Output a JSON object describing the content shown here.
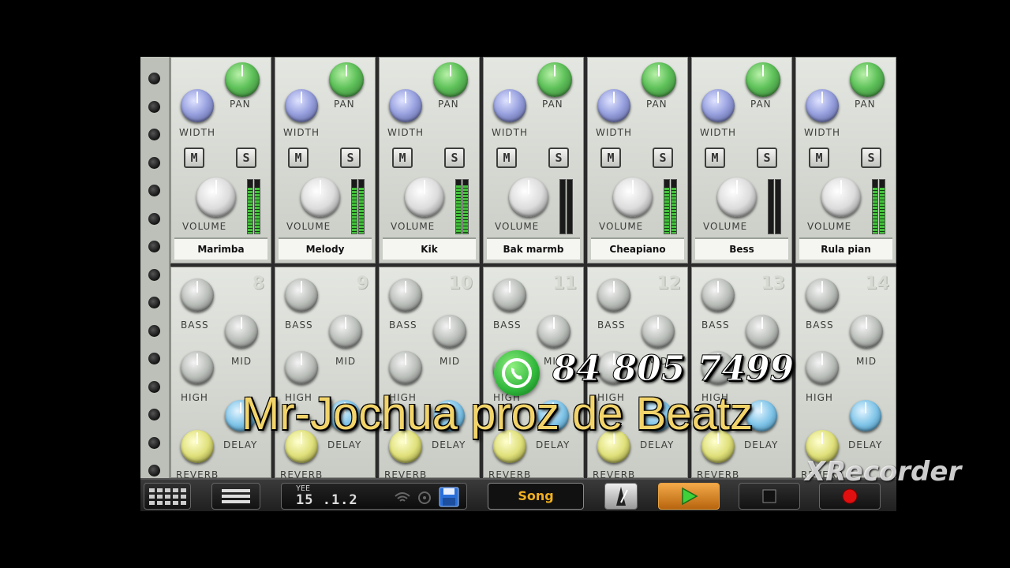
{
  "mixer": {
    "top_labels": {
      "pan": "PAN",
      "width": "WIDTH",
      "volume": "VOLUME",
      "mute": "M",
      "solo": "S"
    },
    "bottom_labels": {
      "bass": "BASS",
      "mid": "MID",
      "high": "HIGH",
      "delay": "DELAY",
      "reverb": "REVERB"
    },
    "channels": [
      {
        "name": "Marimba",
        "number": "8",
        "meter_level": 0.85
      },
      {
        "name": "Melody",
        "number": "9",
        "meter_level": 0.85
      },
      {
        "name": "Kik",
        "number": "10",
        "meter_level": 0.9
      },
      {
        "name": "Bak marmb",
        "number": "11",
        "meter_level": 0.0
      },
      {
        "name": "Cheapiano",
        "number": "12",
        "meter_level": 0.85
      },
      {
        "name": "Bess",
        "number": "13",
        "meter_level": 0.0
      },
      {
        "name": "Rula pian",
        "number": "14",
        "meter_level": 0.85
      }
    ]
  },
  "toolbar": {
    "position_label": "YEE",
    "position_value": "15 .1.2",
    "song_label": "Song"
  },
  "overlay": {
    "phone": "84 805 7499",
    "title": "Mr-Jochua proz de Beatz",
    "watermark": "XRecorder"
  },
  "colors": {
    "song_text": "#f0b020",
    "play": "#e0902a",
    "record": "#e01010",
    "meter": "#44c23c"
  }
}
